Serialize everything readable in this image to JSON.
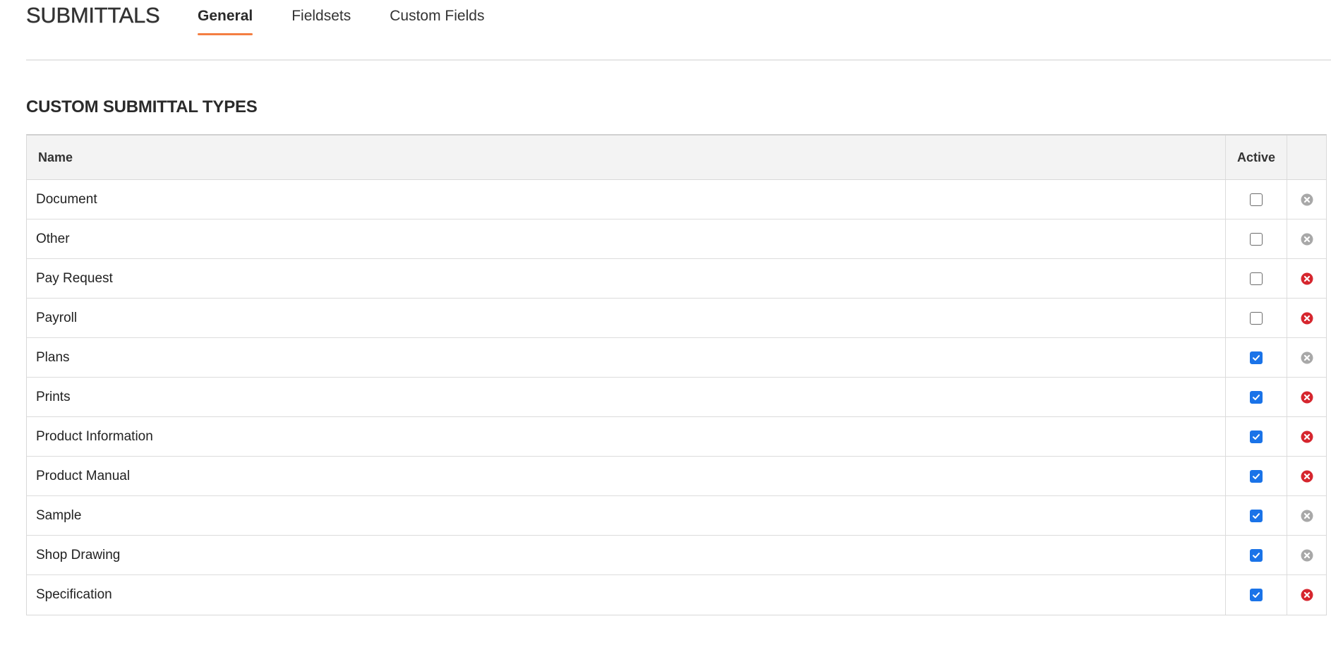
{
  "header": {
    "title": "SUBMITTALS",
    "tabs": [
      {
        "label": "General",
        "active": true
      },
      {
        "label": "Fieldsets",
        "active": false
      },
      {
        "label": "Custom Fields",
        "active": false
      }
    ],
    "accent_color": "#f47e42"
  },
  "section": {
    "title": "CUSTOM SUBMITTAL TYPES"
  },
  "table": {
    "columns": {
      "name": "Name",
      "active": "Active",
      "action": ""
    },
    "rows": [
      {
        "name": "Document",
        "active": false,
        "delete_enabled": false
      },
      {
        "name": "Other",
        "active": false,
        "delete_enabled": false
      },
      {
        "name": "Pay Request",
        "active": false,
        "delete_enabled": true
      },
      {
        "name": "Payroll",
        "active": false,
        "delete_enabled": true
      },
      {
        "name": "Plans",
        "active": true,
        "delete_enabled": false
      },
      {
        "name": "Prints",
        "active": true,
        "delete_enabled": true
      },
      {
        "name": "Product Information",
        "active": true,
        "delete_enabled": true
      },
      {
        "name": "Product Manual",
        "active": true,
        "delete_enabled": true
      },
      {
        "name": "Sample",
        "active": true,
        "delete_enabled": false
      },
      {
        "name": "Shop Drawing",
        "active": true,
        "delete_enabled": false
      },
      {
        "name": "Specification",
        "active": true,
        "delete_enabled": true
      }
    ]
  },
  "colors": {
    "checkbox_checked": "#1a73e8",
    "delete_enabled": "#d6262e",
    "delete_disabled": "#a8a8a8"
  }
}
